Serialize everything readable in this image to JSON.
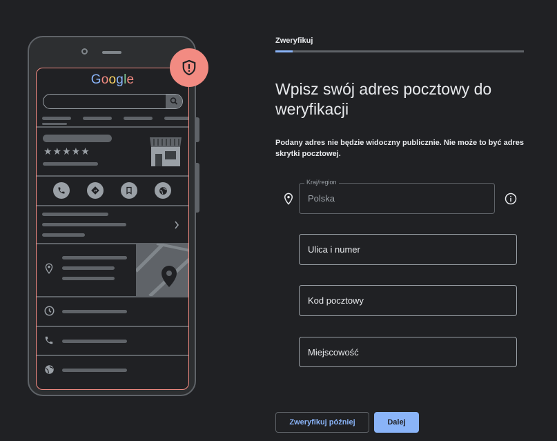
{
  "illustration": {
    "logo": {
      "letters": [
        {
          "char": "G",
          "color": "#8ab4f8"
        },
        {
          "char": "o",
          "color": "#f28b82"
        },
        {
          "char": "o",
          "color": "#fdd663"
        },
        {
          "char": "g",
          "color": "#8ab4f8"
        },
        {
          "char": "l",
          "color": "#81c995"
        },
        {
          "char": "e",
          "color": "#f28b82"
        }
      ]
    },
    "rating_stars": "★★★★★",
    "action_icons": [
      "phone-icon",
      "directions-icon",
      "bookmark-icon",
      "globe-icon"
    ],
    "row_icons": [
      "location-pin-icon",
      "clock-icon",
      "phone-icon",
      "globe-icon"
    ],
    "badge_icon": "shield-alert-icon"
  },
  "stepper": {
    "label": "Zweryfikuj",
    "progress": 0.07
  },
  "form": {
    "title": "Wpisz swój adres pocztowy do weryfikacji",
    "description": "Podany adres nie będzie widoczny publicznie. Nie może to być adres skrytki pocztowej.",
    "country": {
      "label": "Kraj/region",
      "value": "Polska",
      "icon": "location-pin-icon",
      "info_icon": "info-icon"
    },
    "street_placeholder": "Ulica i numer",
    "postal_code_placeholder": "Kod pocztowy",
    "city_placeholder": "Miejscowość"
  },
  "buttons": {
    "later": "Zweryfikuj później",
    "next": "Dalej"
  },
  "colors": {
    "background": "#202124",
    "accent": "#8ab4f8",
    "alert": "#f28b82"
  }
}
